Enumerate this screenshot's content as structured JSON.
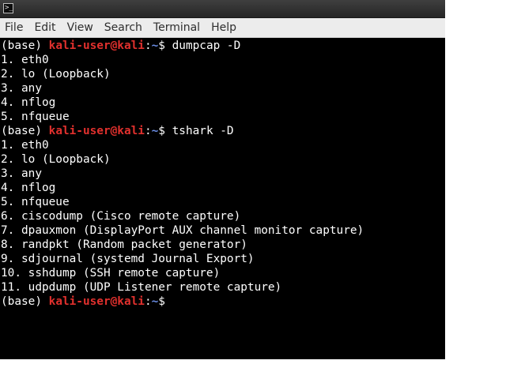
{
  "titlebar": {
    "icon": "terminal-icon",
    "icon_glyph": ">_"
  },
  "menu": [
    "File",
    "Edit",
    "View",
    "Search",
    "Terminal",
    "Help"
  ],
  "prompt": {
    "env": "(base) ",
    "user_host": "kali-user@kali",
    "colon": ":",
    "path": "~",
    "symbol": "$ "
  },
  "colors": {
    "background": "#000000",
    "foreground": "#ffffff",
    "user_host": "#e0302d",
    "path": "#6b8ee6",
    "menubar": "#ececec"
  },
  "commands": [
    {
      "command": "dumpcap -D",
      "output": [
        "1. eth0",
        "2. lo (Loopback)",
        "3. any",
        "4. nflog",
        "5. nfqueue"
      ]
    },
    {
      "command": "tshark -D",
      "output": [
        "1. eth0",
        "2. lo (Loopback)",
        "3. any",
        "4. nflog",
        "5. nfqueue",
        "6. ciscodump (Cisco remote capture)",
        "7. dpauxmon (DisplayPort AUX channel monitor capture)",
        "8. randpkt (Random packet generator)",
        "9. sdjournal (systemd Journal Export)",
        "10. sshdump (SSH remote capture)",
        "11. udpdump (UDP Listener remote capture)"
      ]
    },
    {
      "command": "",
      "output": []
    }
  ]
}
